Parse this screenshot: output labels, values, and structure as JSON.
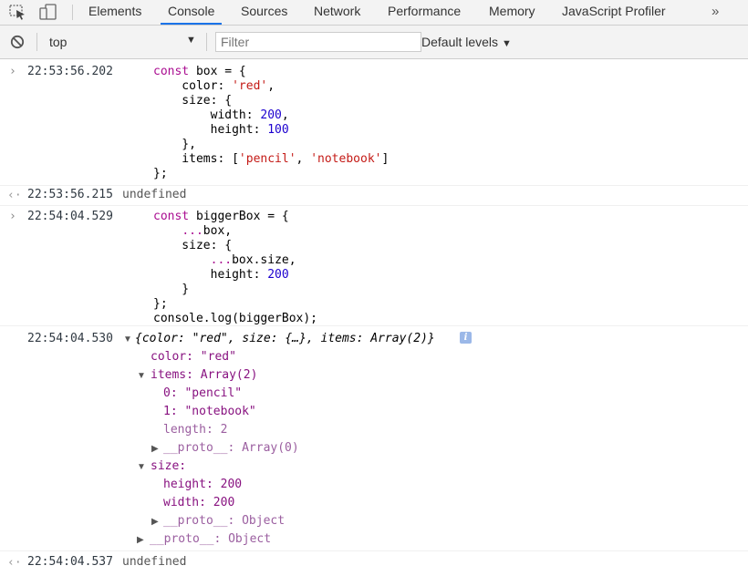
{
  "tabs": [
    "Elements",
    "Console",
    "Sources",
    "Network",
    "Performance",
    "Memory",
    "JavaScript Profiler"
  ],
  "more": "»",
  "toolbar": {
    "context": "top",
    "filter_placeholder": "Filter",
    "levels": "Default levels"
  },
  "entries": {
    "e1": {
      "ts": "22:53:56.202",
      "code": [
        "const box = {",
        "    color: 'red',",
        "    size: {",
        "        width: 200,",
        "        height: 100",
        "    },",
        "    items: ['pencil', 'notebook']",
        "};"
      ]
    },
    "r1": {
      "ts": "22:53:56.215",
      "value": "undefined"
    },
    "e2": {
      "ts": "22:54:04.529",
      "code": [
        "const biggerBox = {",
        "    ...box,",
        "    size: {",
        "        ...box.size,",
        "        height: 200",
        "    }",
        "};",
        "console.log(biggerBox);"
      ]
    },
    "log": {
      "ts": "22:54:04.530",
      "summary": "{color: \"red\", size: {…}, items: Array(2)}",
      "color_line": "color: \"red\"",
      "items_line": "items: Array(2)",
      "item0": "0: \"pencil\"",
      "item1": "1: \"notebook\"",
      "length": "length: 2",
      "items_proto": "__proto__: Array(0)",
      "size_line": "size:",
      "height": "height: 200",
      "width": "width: 200",
      "size_proto": "__proto__: Object",
      "proto": "__proto__: Object"
    },
    "r2": {
      "ts": "22:54:04.537",
      "value": "undefined"
    }
  },
  "colors": {
    "keyword": "#aa0d91",
    "string": "#c41a16",
    "number": "#1c00cf",
    "property": "#881280"
  }
}
